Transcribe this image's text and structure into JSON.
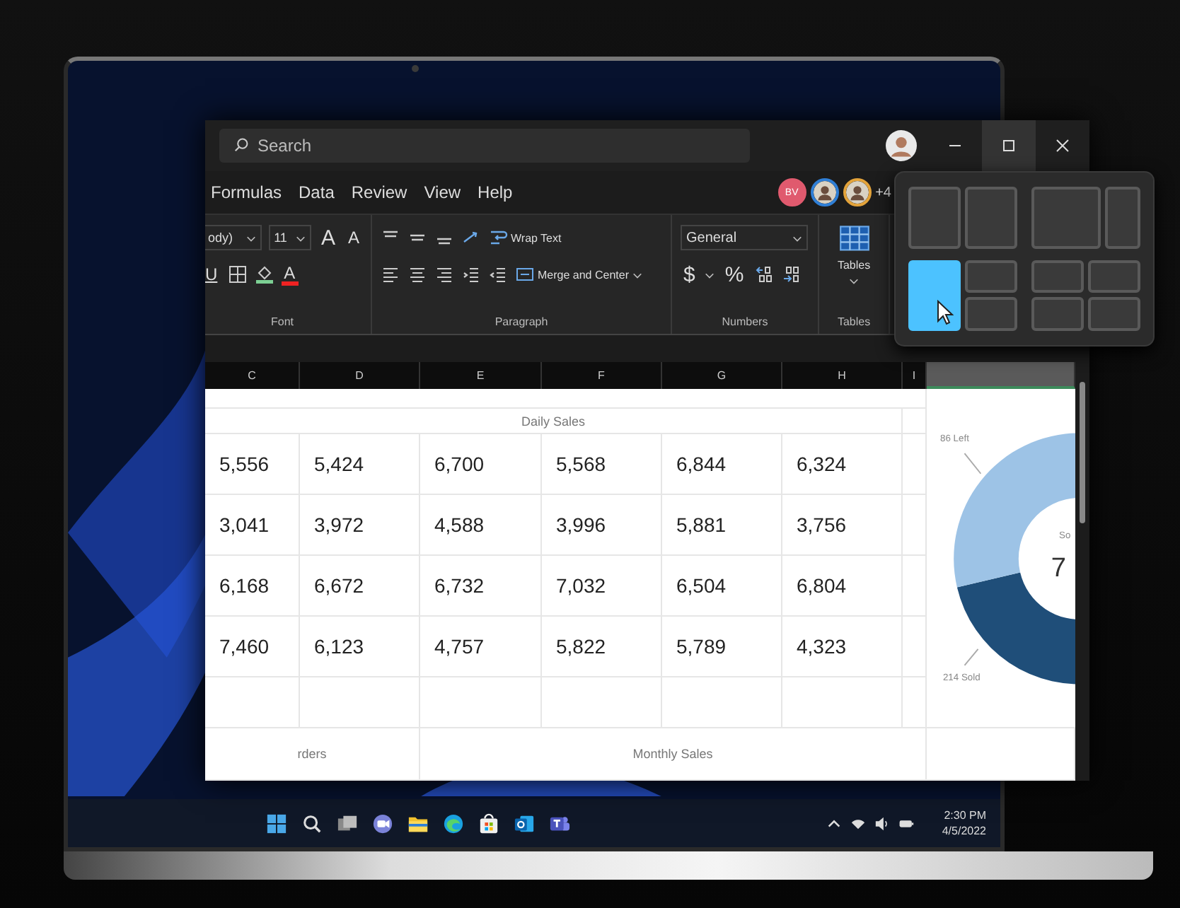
{
  "window": {
    "search": {
      "placeholder": "Search"
    }
  },
  "ribbon_tabs": [
    "Formulas",
    "Data",
    "Review",
    "View",
    "Help"
  ],
  "collaborators": [
    {
      "kind": "initials",
      "text": "BV",
      "color": "#e05a6e"
    },
    {
      "kind": "photo",
      "color": "#2f7fd6"
    },
    {
      "kind": "photo",
      "color": "#e3a33a"
    }
  ],
  "collaborators_more": "+4",
  "ribbon": {
    "font": {
      "font_name": "ody)",
      "font_size": "11",
      "grow": "A",
      "shrink": "A",
      "underline": "U",
      "font_color": "A",
      "label": "Font"
    },
    "paragraph": {
      "wrap": "Wrap Text",
      "merge": "Merge and Center",
      "label": "Paragraph"
    },
    "numbers": {
      "format": "General",
      "currency": "$",
      "percent": "%",
      "label": "Numbers"
    },
    "tables": {
      "button": "Tables",
      "label": "Tables"
    }
  },
  "sheet": {
    "columns": [
      "C",
      "D",
      "E",
      "F",
      "G",
      "H",
      "I"
    ],
    "section_title": "Daily Sales",
    "rows": [
      [
        "5,556",
        "5,424",
        "6,700",
        "5,568",
        "6,844",
        "6,324"
      ],
      [
        "3,041",
        "3,972",
        "4,588",
        "3,996",
        "5,881",
        "3,756"
      ],
      [
        "6,168",
        "6,672",
        "6,732",
        "7,032",
        "6,504",
        "6,804"
      ],
      [
        "7,460",
        "6,123",
        "4,757",
        "5,822",
        "5,789",
        "4,323"
      ]
    ],
    "bottom_titles": [
      "rders",
      "Monthly Sales"
    ],
    "chart": {
      "center_label": "So",
      "center_value": "7",
      "chart_data": {
        "type": "donut",
        "categories": [
          "86 Left",
          "214 Sold"
        ],
        "values": [
          86,
          214
        ]
      }
    }
  },
  "snap_layouts": [
    {
      "kind": "halves",
      "zones": [
        {
          "selected": false
        },
        {
          "selected": false
        }
      ]
    },
    {
      "kind": "two-thirds",
      "zones": [
        {
          "selected": false
        },
        {
          "selected": false
        }
      ]
    },
    {
      "kind": "main-stack",
      "zones": [
        {
          "selected": true
        },
        {
          "selected": false
        },
        {
          "selected": false
        }
      ]
    },
    {
      "kind": "quarters",
      "zones": [
        {
          "selected": false
        },
        {
          "selected": false
        },
        {
          "selected": false
        },
        {
          "selected": false
        }
      ]
    }
  ],
  "taskbar": {
    "time": "2:30 PM",
    "date": "4/5/2022"
  }
}
